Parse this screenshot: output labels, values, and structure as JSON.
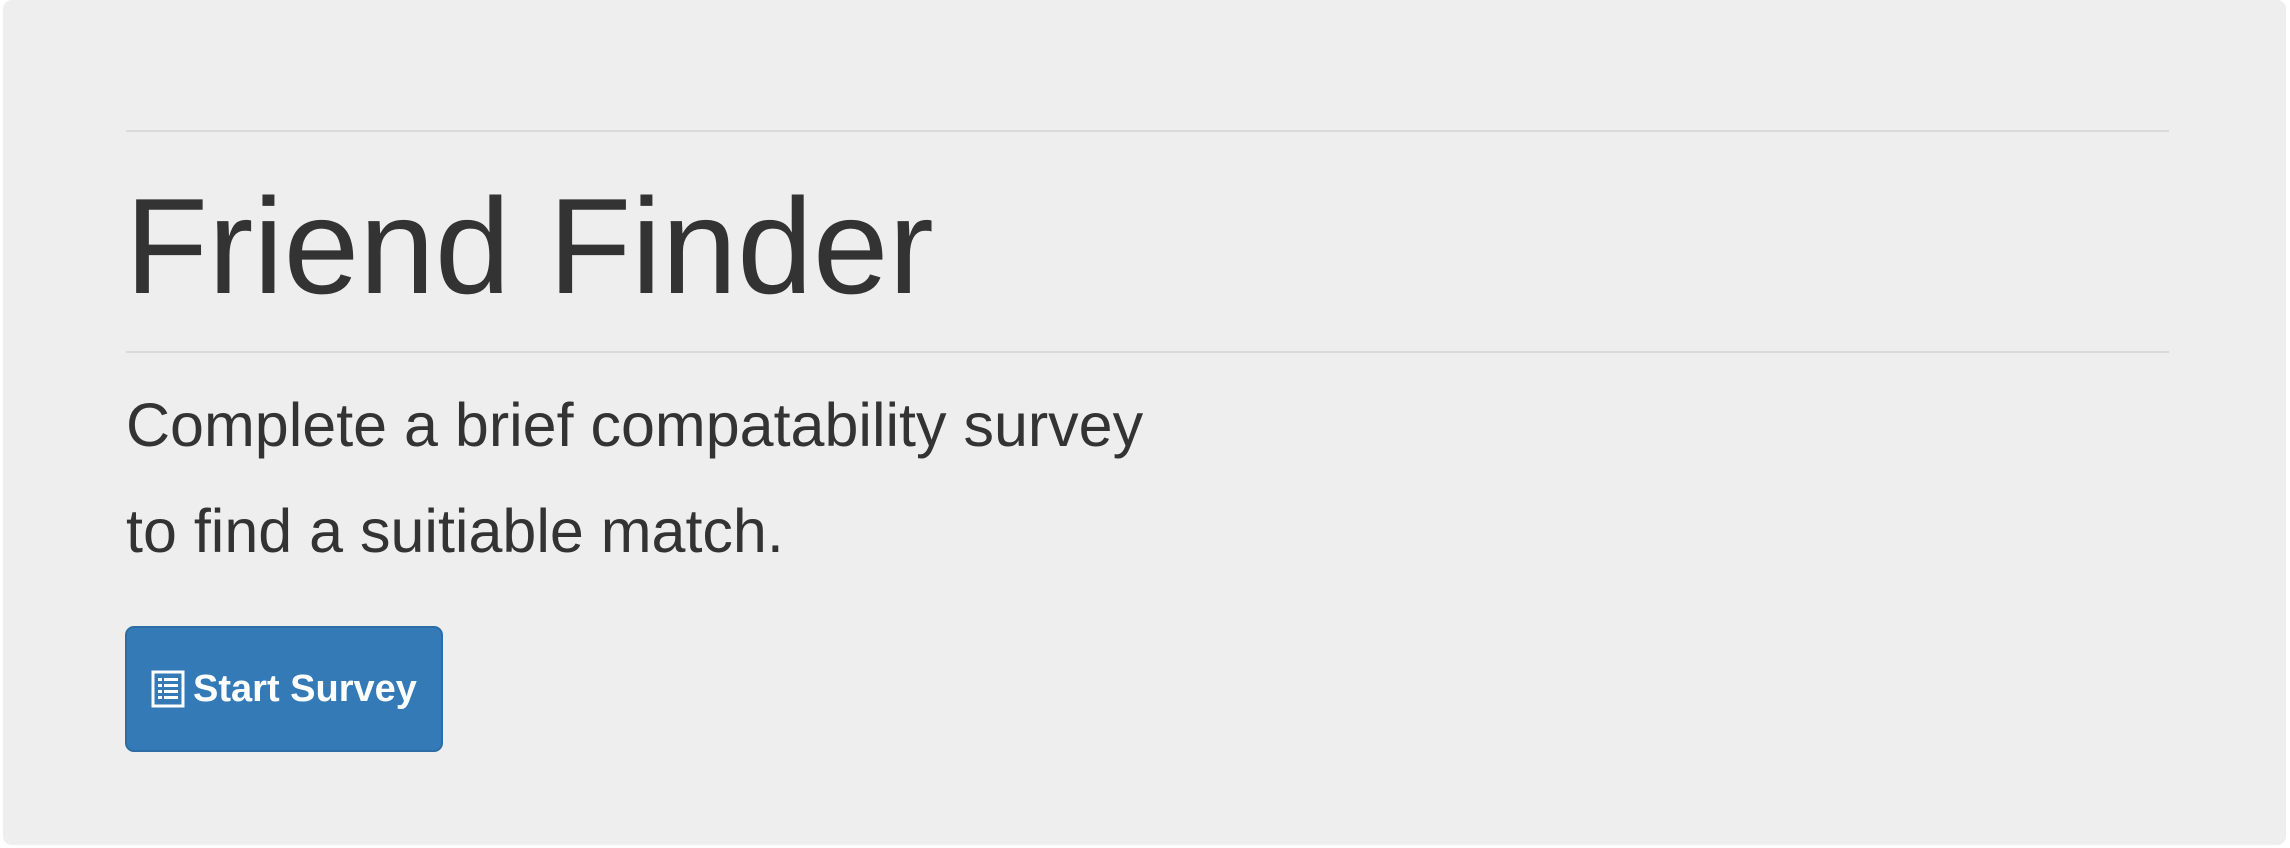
{
  "jumbotron": {
    "title": "Friend Finder",
    "lead_line_1": "Complete a brief compatability survey",
    "lead_line_2": "to find a suitiable match.",
    "button": {
      "label": "Start Survey",
      "icon": "list-alt-icon"
    }
  },
  "colors": {
    "background": "#eeeeee",
    "text": "#333333",
    "button": "#337ab7",
    "button_text": "#ffffff"
  }
}
